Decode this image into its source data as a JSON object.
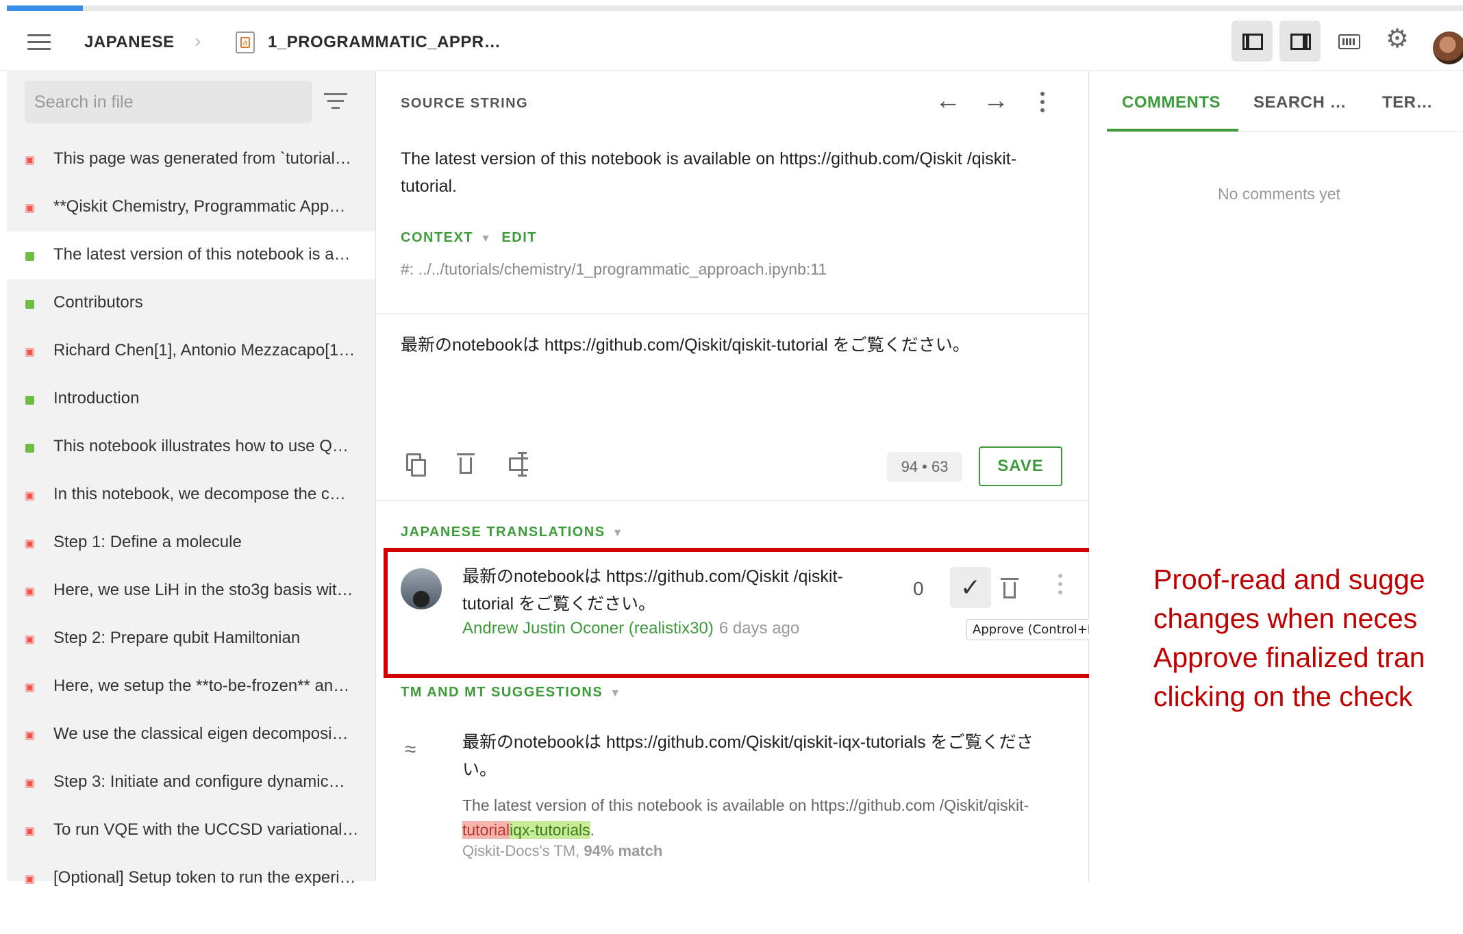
{
  "progress": {
    "percent": 5.2,
    "color": "#3b8ee8"
  },
  "header": {
    "project": "JAPANESE",
    "file_name": "1_PROGRAMMATIC_APPR…",
    "icons": [
      "menu-icon",
      "chevron-right-icon",
      "file-icon",
      "layout-left-icon",
      "layout-right-icon",
      "keyboard-icon",
      "gear-icon",
      "avatar"
    ]
  },
  "sidebar": {
    "search_placeholder": "Search in file",
    "items": [
      {
        "label": "This page was generated from `tutorial…",
        "status": "untranslated"
      },
      {
        "label": "**Qiskit Chemistry, Programmatic App…",
        "status": "untranslated"
      },
      {
        "label": "The latest version of this notebook is a…",
        "status": "translated"
      },
      {
        "label": "Contributors",
        "status": "translated"
      },
      {
        "label": "Richard Chen[1], Antonio Mezzacapo[1…",
        "status": "untranslated"
      },
      {
        "label": "Introduction",
        "status": "translated"
      },
      {
        "label": "This notebook illustrates how to use Q…",
        "status": "translated"
      },
      {
        "label": "In this notebook, we decompose the c…",
        "status": "untranslated"
      },
      {
        "label": "Step 1: Define a molecule",
        "status": "untranslated"
      },
      {
        "label": "Here, we use LiH in the sto3g basis wit…",
        "status": "untranslated"
      },
      {
        "label": "Step 2: Prepare qubit Hamiltonian",
        "status": "untranslated"
      },
      {
        "label": "Here, we setup the **to-be-frozen** an…",
        "status": "untranslated"
      },
      {
        "label": "We use the classical eigen decomposi…",
        "status": "untranslated"
      },
      {
        "label": "Step 3: Initiate and configure dynamic…",
        "status": "untranslated"
      },
      {
        "label": "To run VQE with the UCCSD variational…",
        "status": "untranslated"
      },
      {
        "label": "[Optional] Setup token to run the experi…",
        "status": "untranslated"
      }
    ],
    "status_colors": {
      "untranslated": "#ef5350",
      "translated": "#6cbe45"
    }
  },
  "editor": {
    "source_label": "SOURCE STRING",
    "source_text": "The latest version of this notebook is available on https://github.com/Qiskit /qiskit-tutorial.",
    "context_label": "CONTEXT",
    "edit_label": "EDIT",
    "context_path": "#: ../../tutorials/chemistry/1_programmatic_approach.ipynb:11",
    "translation_text": "最新のnotebookは https://github.com/Qiskit/qiskit-tutorial をご覧ください。",
    "char_count": "94 • 63",
    "save_label": "SAVE"
  },
  "translations": {
    "label": "JAPANESE TRANSLATIONS",
    "item": {
      "text": "最新のnotebookは https://github.com/Qiskit /qiskit-tutorial をご覧ください。",
      "author": "Andrew Justin Oconer (realistix30)",
      "time": "6 days ago",
      "votes": "0",
      "approve_tooltip": "Approve (Control+L)"
    }
  },
  "suggestions": {
    "label": "TM AND MT SUGGESTIONS",
    "item": {
      "text": "最新のnotebookは https://github.com/Qiskit/qiskit-iqx-tutorials をご覧ください。",
      "source_prefix": "The latest version of this notebook is available on https://github.com /Qiskit/qiskit-",
      "source_deleted": "tutorial",
      "source_inserted": "iqx-tutorials",
      "source_suffix": ".",
      "origin": "Qiskit-Docs's TM,",
      "match": "94% match"
    }
  },
  "right_panel": {
    "tabs": [
      "COMMENTS",
      "SEARCH …",
      "TER…"
    ],
    "empty_text": "No comments yet"
  },
  "annotation": {
    "lines": [
      "Proof-read and sugge",
      "changes when neces",
      "Approve finalized tran",
      "clicking on the check"
    ],
    "color": "#c00000"
  },
  "accent_color": "#3d9c3a"
}
